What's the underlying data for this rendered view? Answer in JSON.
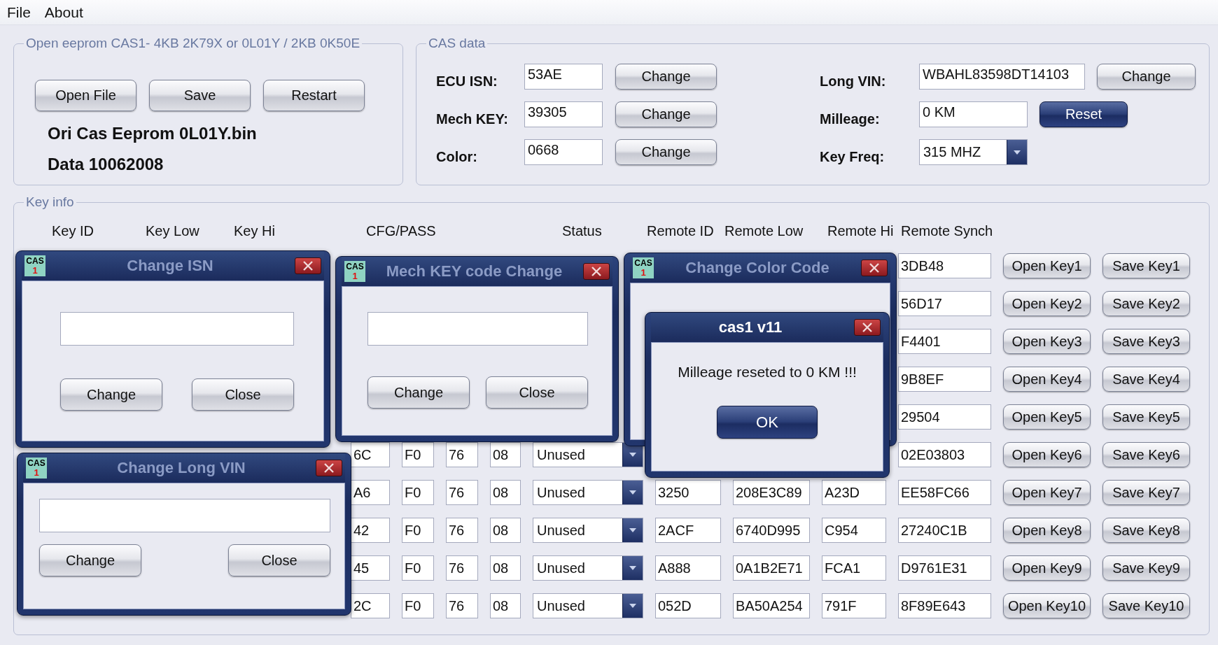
{
  "menu": [
    "File",
    "About"
  ],
  "eeprom_group": {
    "title": "Open eeprom CAS1- 4KB 2K79X or 0L01Y / 2KB 0K50E",
    "buttons": [
      "Open File",
      "Save",
      "Restart"
    ],
    "file_name": "Ori Cas Eeprom 0L01Y.bin",
    "date": "Data 10062008"
  },
  "cas_data": {
    "title": "CAS data",
    "fields_left": [
      {
        "label": "ECU ISN:",
        "kind": "text",
        "value": "53AE",
        "button": {
          "label": "Change",
          "default": false
        }
      },
      {
        "label": "Mech KEY:",
        "kind": "text",
        "value": "39305",
        "button": {
          "label": "Change",
          "default": false
        }
      },
      {
        "label": "Color:",
        "kind": "text",
        "value": "0668",
        "button": {
          "label": "Change",
          "default": false
        }
      }
    ],
    "fields_right": [
      {
        "label": "Long VIN:",
        "kind": "text",
        "value": "WBAHL83598DT14103",
        "button": {
          "label": "Change",
          "default": false
        }
      },
      {
        "label": "Milleage:",
        "kind": "text",
        "value": "0 KM",
        "button": {
          "label": "Reset",
          "default": true
        }
      },
      {
        "label": "Key Freq:",
        "kind": "dropdown",
        "value": "315 MHZ"
      }
    ]
  },
  "key_info": {
    "title": "Key info",
    "columns": [
      "Key ID",
      "Key Low",
      "Key Hi",
      "CFG/PASS",
      "Status",
      "Remote ID",
      "Remote Low",
      "Remote Hi",
      "Remote Synch"
    ],
    "rows": [
      {
        "remote_synch": "3DB48",
        "open_button": "Open Key1",
        "save_button": "Save Key1"
      },
      {
        "remote_synch": "56D17",
        "open_button": "Open Key2",
        "save_button": "Save Key2"
      },
      {
        "remote_synch": "F4401",
        "open_button": "Open Key3",
        "save_button": "Save Key3"
      },
      {
        "remote_synch": "9B8EF",
        "open_button": "Open Key4",
        "save_button": "Save Key4"
      },
      {
        "remote_synch": "29504",
        "open_button": "Open Key5",
        "save_button": "Save Key5"
      },
      {
        "cfg_1": "6C",
        "cfg_2": "F0",
        "cfg_3": "76",
        "cfg_4": "08",
        "status": "Unused",
        "remote_synch": "02E03803",
        "open_button": "Open Key6",
        "save_button": "Save Key6"
      },
      {
        "cfg_1": "A6",
        "cfg_2": "F0",
        "cfg_3": "76",
        "cfg_4": "08",
        "status": "Unused",
        "remote_id": "3250",
        "remote_low": "208E3C89",
        "remote_hi": "A23D",
        "remote_synch": "EE58FC66",
        "open_button": "Open Key7",
        "save_button": "Save Key7"
      },
      {
        "cfg_1": "42",
        "cfg_2": "F0",
        "cfg_3": "76",
        "cfg_4": "08",
        "status": "Unused",
        "remote_id": "2ACF",
        "remote_low": "6740D995",
        "remote_hi": "C954",
        "remote_synch": "27240C1B",
        "open_button": "Open Key8",
        "save_button": "Save Key8"
      },
      {
        "cfg_1": "45",
        "cfg_2": "F0",
        "cfg_3": "76",
        "cfg_4": "08",
        "status": "Unused",
        "remote_id": "A888",
        "remote_low": "0A1B2E71",
        "remote_hi": "FCA1",
        "remote_synch": "D9761E31",
        "open_button": "Open Key9",
        "save_button": "Save Key9"
      },
      {
        "cfg_1": "2C",
        "cfg_2": "F0",
        "cfg_3": "76",
        "cfg_4": "08",
        "status": "Unused",
        "remote_id": "052D",
        "remote_low": "BA50A254",
        "remote_hi": "791F",
        "remote_synch": "8F89E643",
        "open_button": "Open Key10",
        "save_button": "Save Key10"
      }
    ]
  },
  "dialogs": [
    {
      "title": "Change ISN",
      "kind": "input",
      "active": false,
      "icon_text": "CAS",
      "icon_sub": "1",
      "buttons": [
        {
          "label": "Change",
          "default": false
        },
        {
          "label": "Close",
          "default": false
        }
      ]
    },
    {
      "title": "Mech KEY code Change",
      "kind": "input",
      "active": false,
      "icon_text": "CAS",
      "icon_sub": "1",
      "buttons": [
        {
          "label": "Change",
          "default": false
        },
        {
          "label": "Close",
          "default": false
        }
      ]
    },
    {
      "title": "Change Color Code",
      "kind": "blank",
      "active": false,
      "icon_text": "CAS",
      "icon_sub": "1"
    },
    {
      "title": "cas1 v11",
      "kind": "message",
      "active": true,
      "message": "Milleage reseted to 0 KM !!!",
      "buttons": [
        {
          "label": "OK",
          "default": true
        }
      ]
    },
    {
      "title": "Change Long VIN",
      "kind": "input",
      "active": false,
      "icon_text": "CAS",
      "icon_sub": "1",
      "buttons": [
        {
          "label": "Change",
          "default": false
        },
        {
          "label": "Close",
          "default": false
        }
      ]
    }
  ]
}
